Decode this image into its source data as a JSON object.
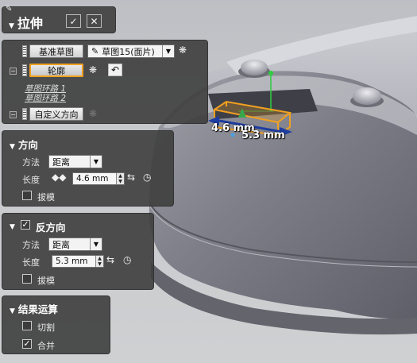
{
  "dialog": {
    "title": "拉伸",
    "confirm_icon": "checkmark-icon",
    "cancel_icon": "close-x-icon"
  },
  "selection": {
    "base_sketch_button": "基准草图",
    "sketch_combo": "草图15(面片)",
    "profile_button": "轮廓",
    "profile_items": [
      "草图环路 1",
      "草图环路 2"
    ],
    "custom_direction_button": "自定义方向"
  },
  "direction": {
    "title": "方向",
    "method_label": "方法",
    "method_value": "距离",
    "length_label": "长度",
    "length_value": "4.6 mm",
    "draft_label": "拔模",
    "draft_checked": false
  },
  "reverse_direction": {
    "title": "反方向",
    "enabled": true,
    "method_label": "方法",
    "method_value": "距离",
    "length_label": "长度",
    "length_value": "5.3 mm",
    "draft_label": "拔模",
    "draft_checked": false
  },
  "boolean_ops": {
    "title": "结果运算",
    "cut_label": "切割",
    "cut_checked": false,
    "merge_label": "合并",
    "merge_checked": true
  },
  "viewport": {
    "dim_forward": "4.6 mm",
    "dim_reverse": "5.3 mm",
    "highlight_color": "#f0a020",
    "model_color": "#8c8d96"
  }
}
